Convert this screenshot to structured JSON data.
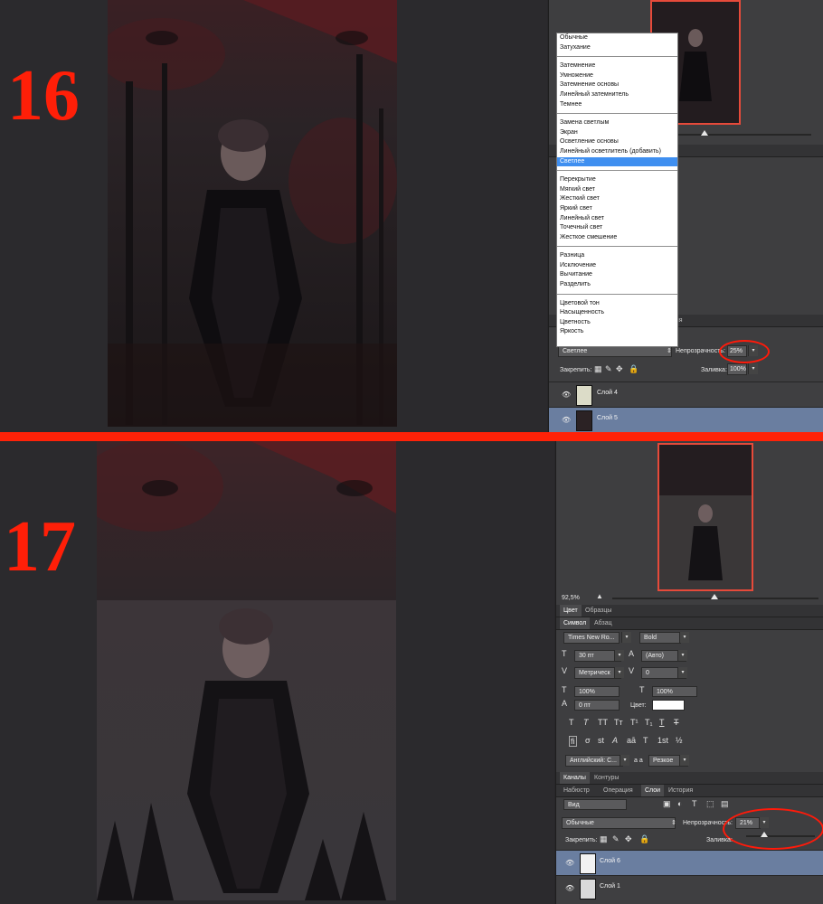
{
  "step16": {
    "number": "16",
    "blend_menu": {
      "groups": [
        [
          "Обычные",
          "Затухание"
        ],
        [
          "Затемнение",
          "Умножение",
          "Затемнение основы",
          "Линейный затемнитель",
          "Темнее"
        ],
        [
          "Замена светлым",
          "Экран",
          "Осветление основы",
          "Линейный осветлитель (добавить)",
          "Светлее"
        ],
        [
          "Перекрытие",
          "Мягкий свет",
          "Жесткий свет",
          "Яркий свет",
          "Линейный свет",
          "Точечный свет",
          "Жесткое смешение"
        ],
        [
          "Разница",
          "Исключение",
          "Вычитание",
          "Разделить"
        ],
        [
          "Цветовой тон",
          "Насыщенность",
          "Цветность",
          "Яркость"
        ]
      ],
      "selected": "Светлее"
    },
    "tab_fragment": "ория",
    "blend_mode": "Светлее",
    "opacity_label": "Непрозрачность:",
    "opacity_value": "25%",
    "lock_label": "Закрепить:",
    "fill_label": "Заливка:",
    "fill_value": "100%",
    "layers": [
      {
        "name": "Слой 4",
        "selected": false
      },
      {
        "name": "Слой 5",
        "selected": true
      }
    ]
  },
  "step17": {
    "number": "17",
    "zoom": "92,5%",
    "color_tabs": [
      "Цвет",
      "Образцы"
    ],
    "char_tabs": [
      "Символ",
      "Абзац"
    ],
    "font_family": "Times New Ro...",
    "font_style": "Bold",
    "font_size": "30 пт",
    "leading": "(Авто)",
    "kerning": "Метрическ",
    "tracking": "0",
    "vscale": "100%",
    "hscale": "100%",
    "baseline": "0 пт",
    "color_label": "Цвет:",
    "language": "Английский: С...",
    "aa_label": "a a",
    "aa_mode": "Резкое",
    "channel_tabs": [
      "Каналы",
      "Контуры"
    ],
    "layer_tabs": [
      "Набюстр",
      "Операция",
      "Слои",
      "История"
    ],
    "filter_kind": "Вид",
    "blend_mode": "Обычные",
    "opacity_label": "Непрозрачность:",
    "opacity_value": "21%",
    "lock_label": "Закрепить:",
    "fill_label": "Заливка:",
    "fill_value": "100%",
    "layers": [
      {
        "name": "Слой 6",
        "selected": true
      },
      {
        "name": "Слой 1",
        "selected": false
      }
    ]
  },
  "colors": {
    "accent_red": "#ff1f08",
    "selection_blue": "#3f8ff0",
    "layer_selected": "#6a7ea0"
  }
}
